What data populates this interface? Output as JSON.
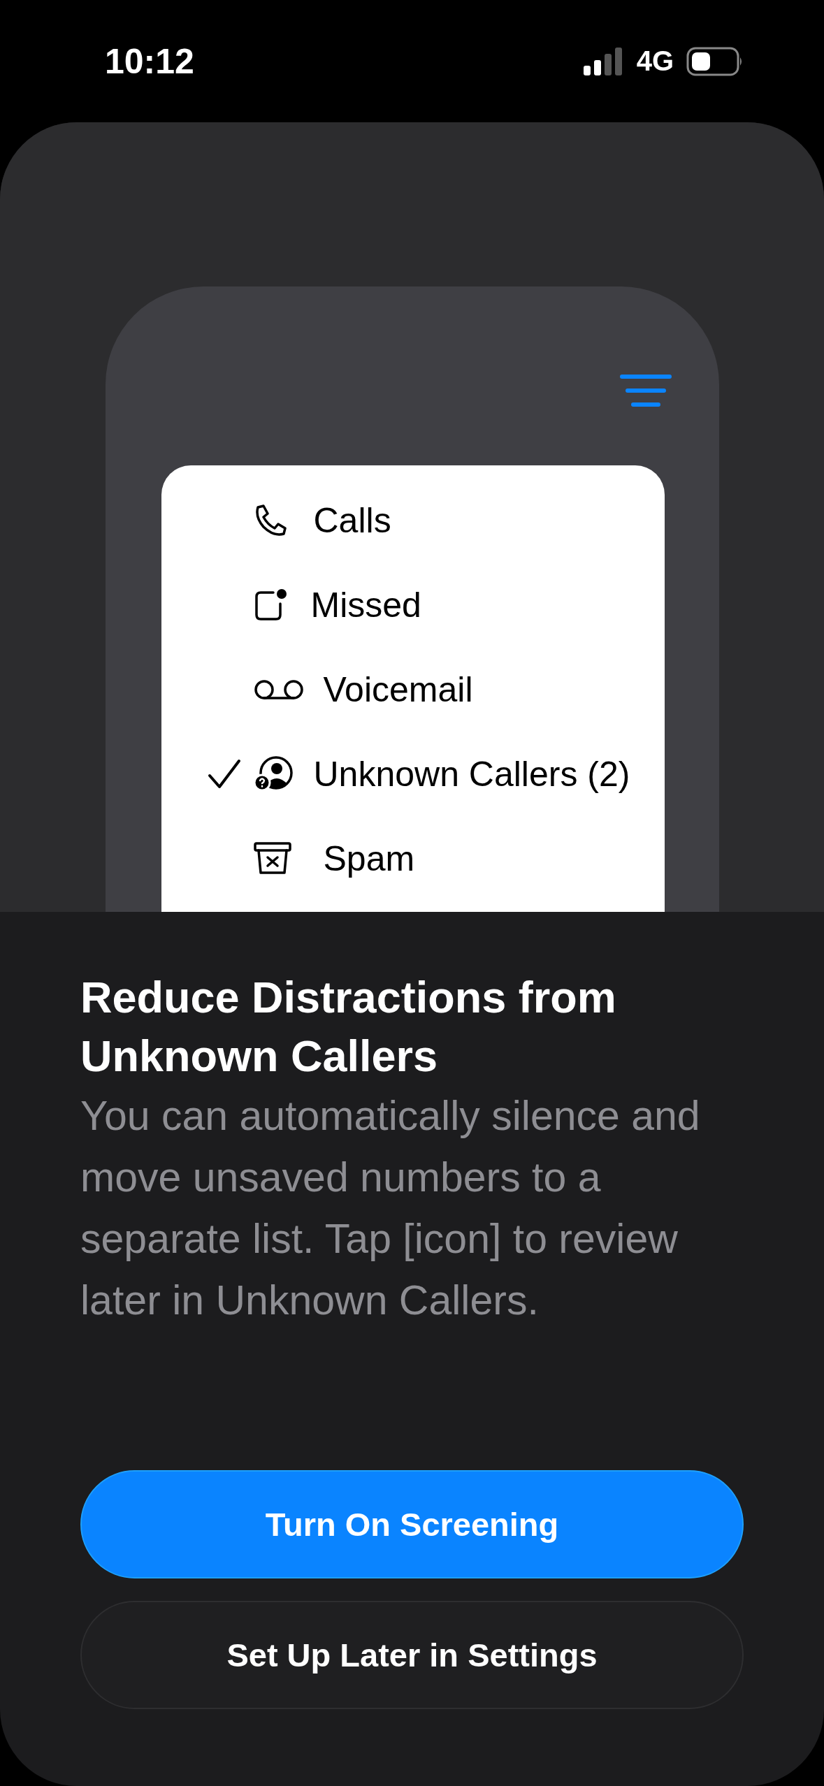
{
  "status_bar": {
    "time": "10:12",
    "network": "4G"
  },
  "filter_menu": {
    "items": [
      {
        "label": "Calls",
        "selected": false
      },
      {
        "label": "Missed",
        "selected": false
      },
      {
        "label": "Voicemail",
        "selected": false
      },
      {
        "label": "Unknown Callers (2)",
        "selected": true
      },
      {
        "label": "Spam",
        "selected": false
      }
    ]
  },
  "title": "Reduce Distractions from Unknown Callers",
  "body": "You can automatically silence and move unsaved numbers to a separate list. Tap [icon] to review later in Unknown Callers.",
  "buttons": [
    {
      "label": "Turn On Screening",
      "kind": "primary"
    },
    {
      "label": "Set Up Later in Settings",
      "kind": "secondary"
    }
  ]
}
